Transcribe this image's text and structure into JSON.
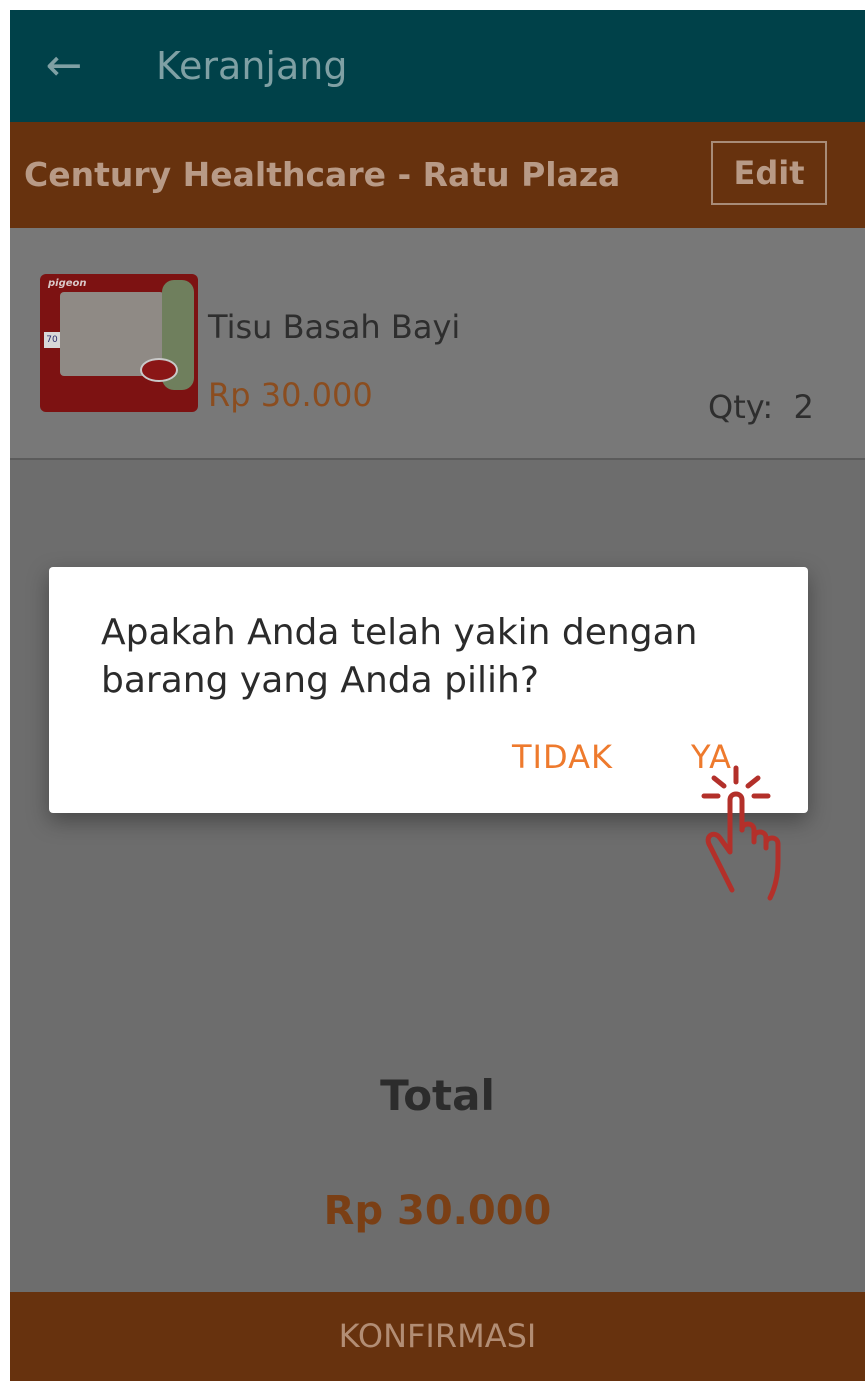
{
  "app_bar": {
    "title": "Keranjang",
    "back_icon": "arrow-left-icon"
  },
  "store": {
    "name": "Century Healthcare - Ratu Plaza",
    "edit_label": "Edit"
  },
  "cart_items": [
    {
      "name": "Tisu Basah Bayi",
      "price": "Rp 30.000",
      "qty_label": "Qty:",
      "qty_value": "2",
      "thumbnail": {
        "brand": "pigeon",
        "count": "70"
      }
    }
  ],
  "summary": {
    "total_label": "Total",
    "total_value": "Rp 30.000"
  },
  "footer": {
    "confirm_label": "KONFIRMASI"
  },
  "dialog": {
    "message": "Apakah Anda telah yakin dengan barang yang Anda pilih?",
    "no_label": "TIDAK",
    "yes_label": "YA"
  },
  "colors": {
    "app_bar": "#004149",
    "store_bar": "#67320e",
    "accent_orange": "#ee7a2d",
    "overlay_gray": "#6d6d6d",
    "tap_indicator": "#b3302a"
  }
}
